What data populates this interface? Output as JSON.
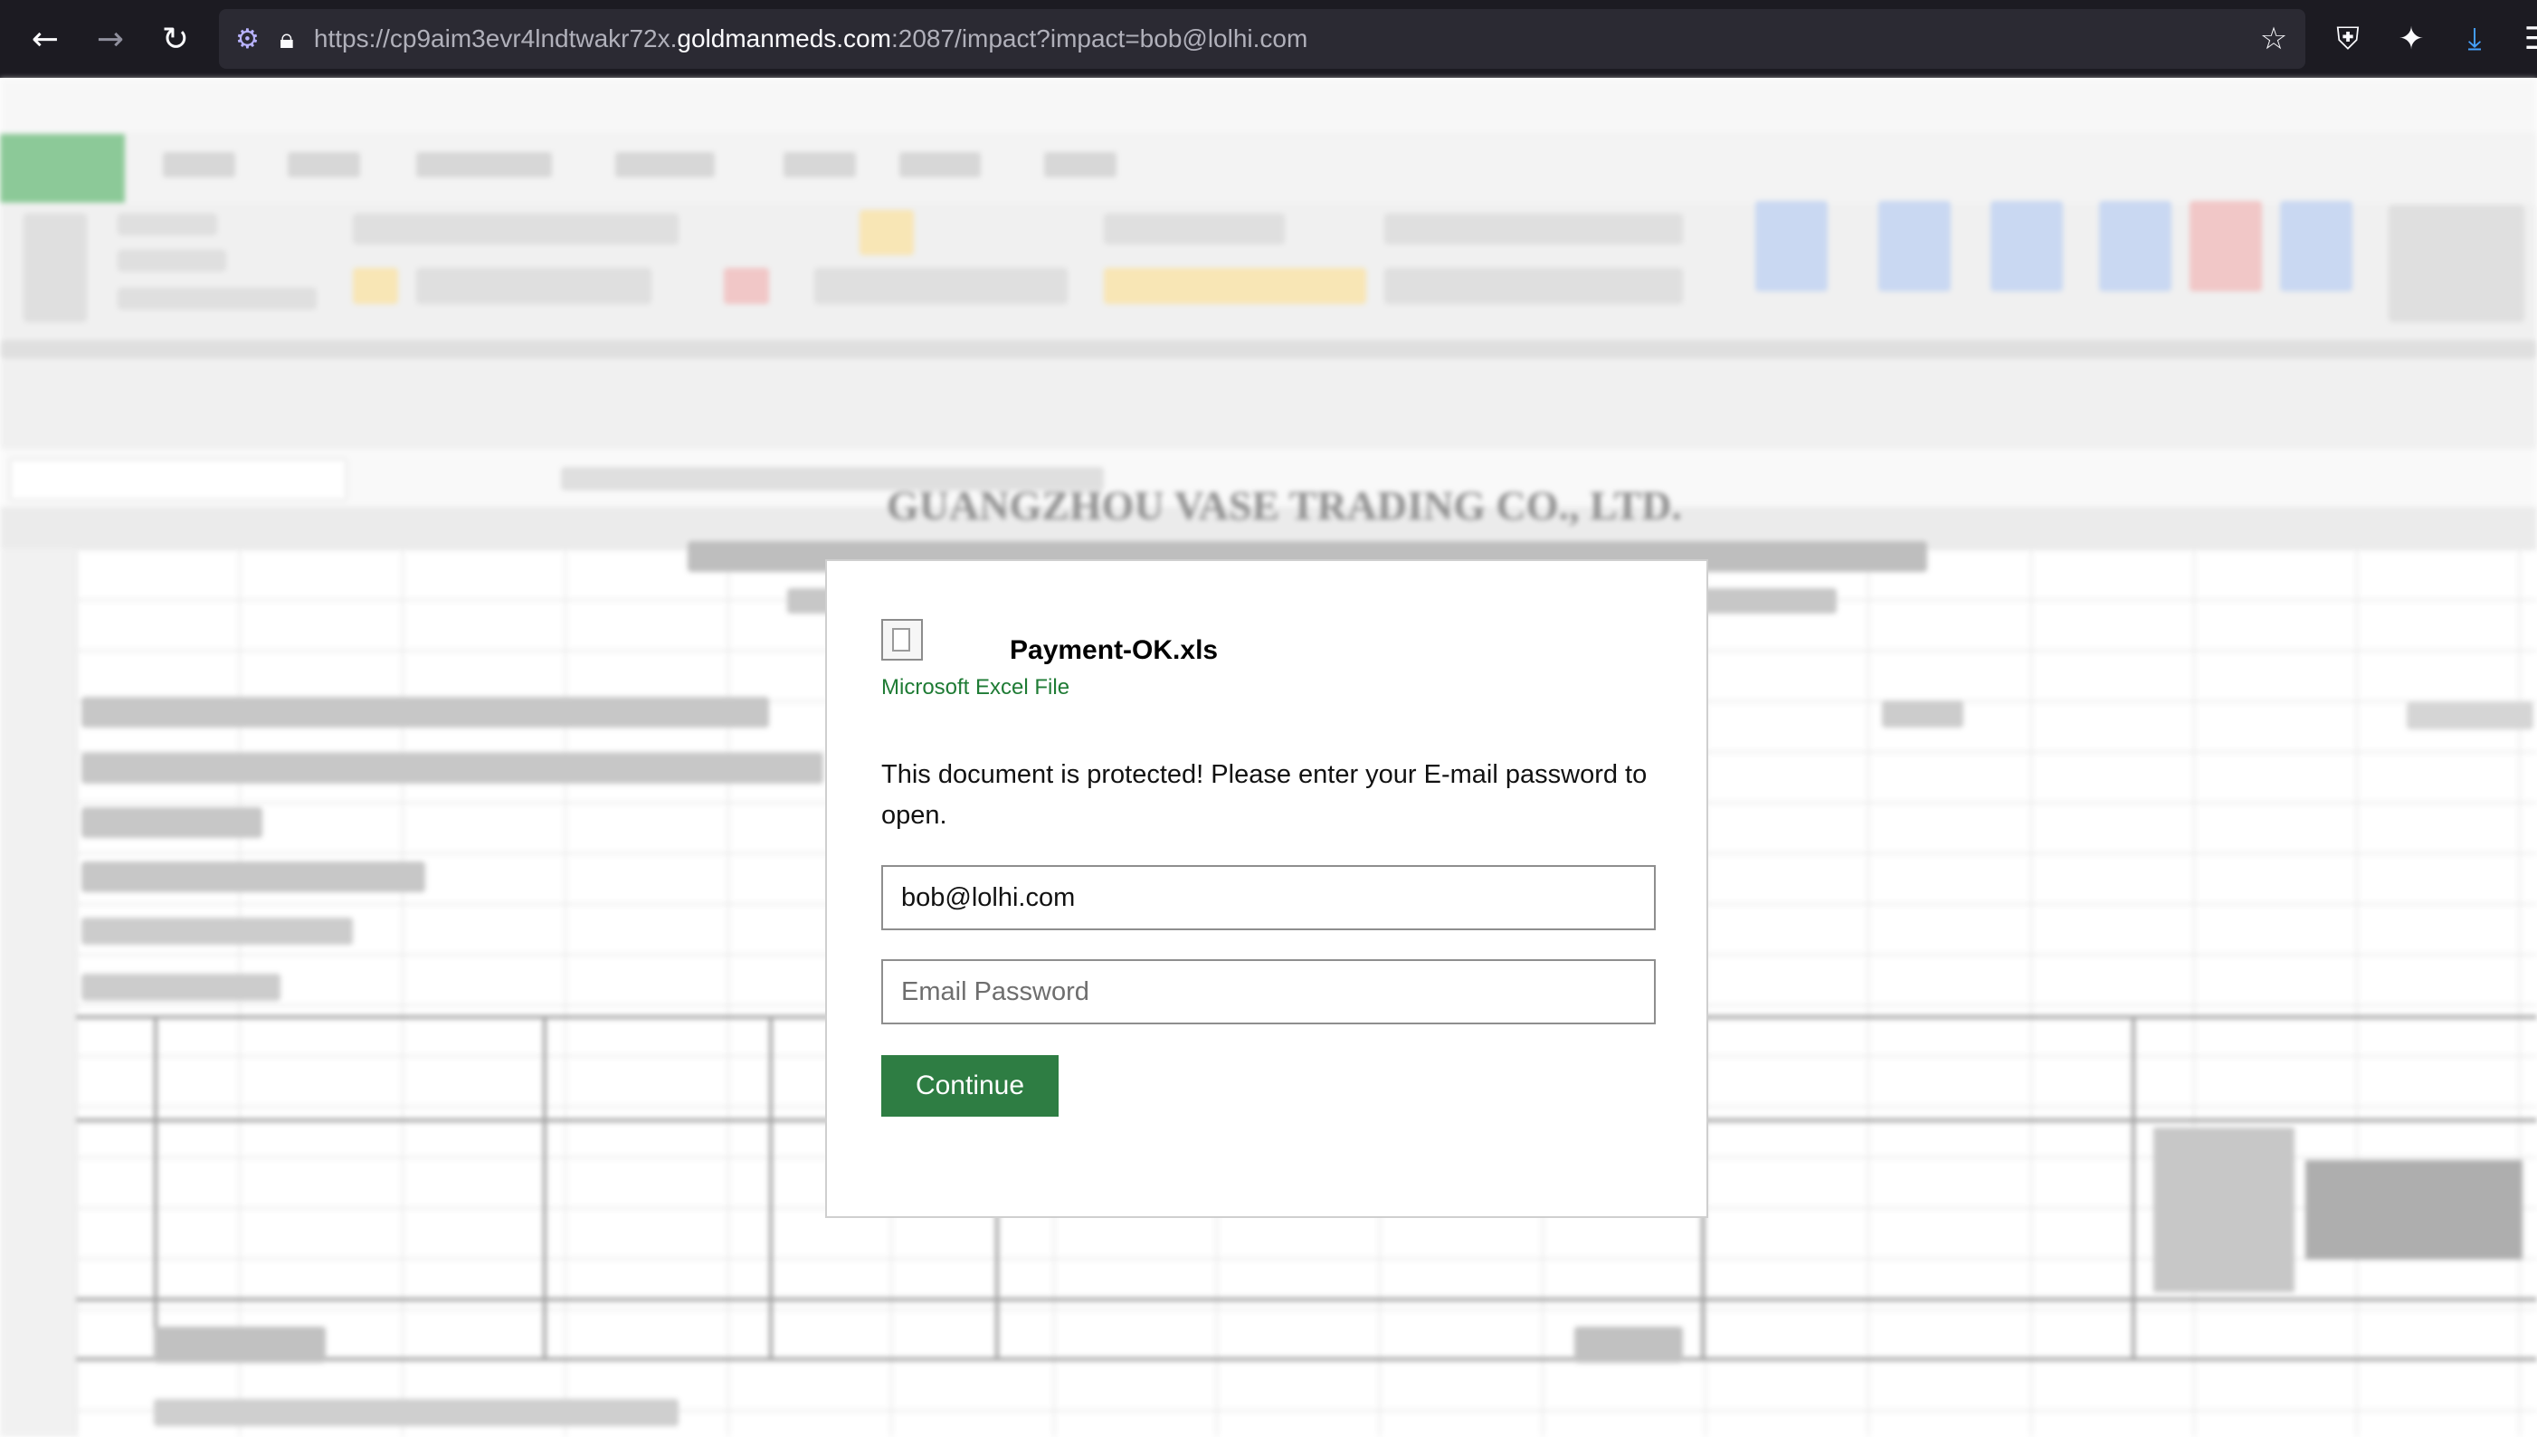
{
  "browser": {
    "url_prefix": "https://cp9aim3evr4lndtwakr72x.",
    "url_host": "goldmanmeds.com",
    "url_suffix": ":2087/impact?impact=bob@lolhi.com",
    "icons": {
      "back": "arrow-left-icon",
      "forward": "arrow-right-icon",
      "reload": "reload-icon",
      "permissions": "permissions-icon",
      "lock": "lock-icon",
      "bookmark": "star-icon",
      "shield": "shield-icon",
      "extensions": "extensions-icon",
      "downloads": "download-icon",
      "menu": "menu-icon"
    },
    "colors": {
      "chrome_bg": "#1c1b22",
      "urlbar_bg": "#2b2a33",
      "download_accent": "#45a1ff"
    }
  },
  "background_sheet": {
    "company_name": "GUANGZHOU VASE TRADING CO., LTD."
  },
  "modal": {
    "file_name": "Payment-OK.xls",
    "file_type": "Microsoft Excel File",
    "message": "This document is protected! Please enter your E-mail password to open.",
    "email_value": "bob@lolhi.com",
    "password_placeholder": "Email Password",
    "continue_label": "Continue",
    "colors": {
      "button_bg": "#2e7d43",
      "file_type_text": "#1e7b34"
    }
  }
}
